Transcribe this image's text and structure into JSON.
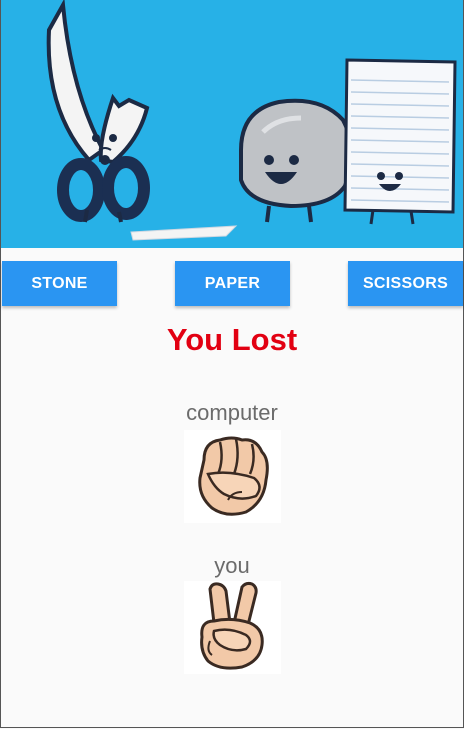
{
  "banner": {
    "image": "stone-paper-scissors-cartoon",
    "background_color": "#27b1e7"
  },
  "buttons": {
    "stone": "STONE",
    "paper": "PAPER",
    "scissors": "SCISSORS",
    "color": "#2a95f2"
  },
  "result": {
    "text": "You Lost",
    "color": "#e20012"
  },
  "computer": {
    "label": "computer",
    "choice_icon": "fist-stone-icon"
  },
  "player": {
    "label": "you",
    "choice_icon": "victory-scissors-icon"
  }
}
